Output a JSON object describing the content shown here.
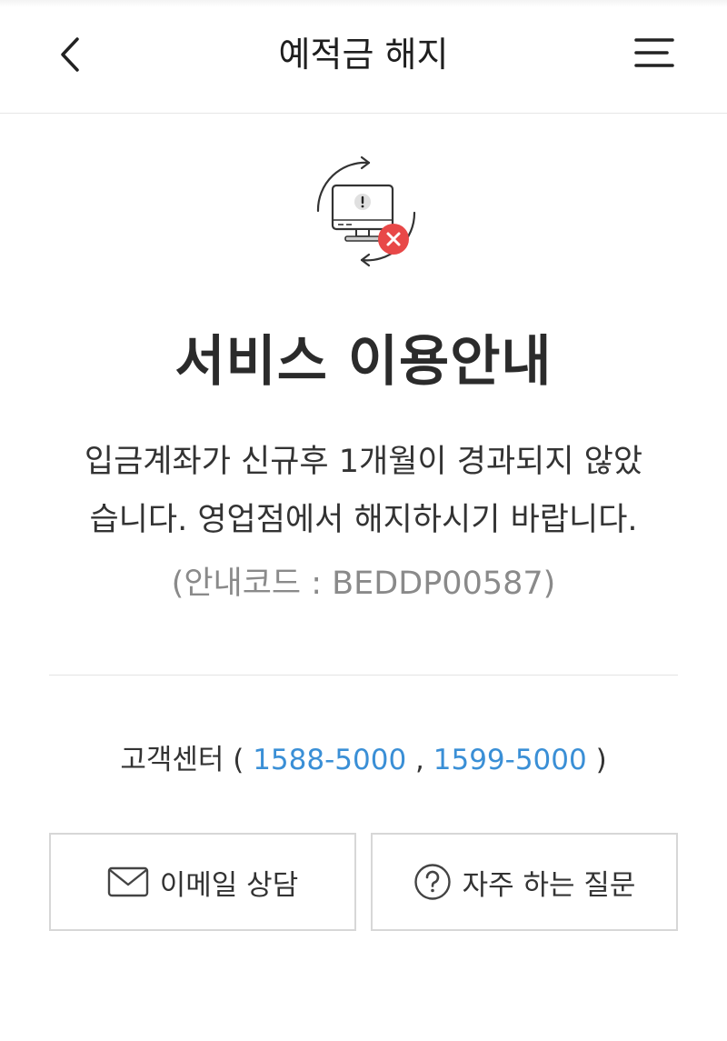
{
  "header": {
    "title": "예적금 해지"
  },
  "notice": {
    "title": "서비스 이용안내",
    "message_line1": "입금계좌가 신규후 1개월이 경과되지 않았",
    "message_line2": "습니다. 영업점에서 해지하시기 바랍니다.",
    "code": "(안내코드 : BEDDP00587)"
  },
  "customer_center": {
    "label": "고객센터 (",
    "phone1": "1588-5000",
    "separator": " , ",
    "phone2": "1599-5000",
    "suffix": " )"
  },
  "actions": {
    "email_label": "이메일 상담",
    "faq_label": "자주 하는 질문"
  },
  "colors": {
    "accent_link": "#3a8fd6",
    "error_badge": "#e84848"
  },
  "icons": {
    "back": "chevron-left-icon",
    "menu": "hamburger-menu-icon",
    "illustration": "monitor-error-icon",
    "email": "envelope-icon",
    "faq": "question-circle-icon"
  }
}
